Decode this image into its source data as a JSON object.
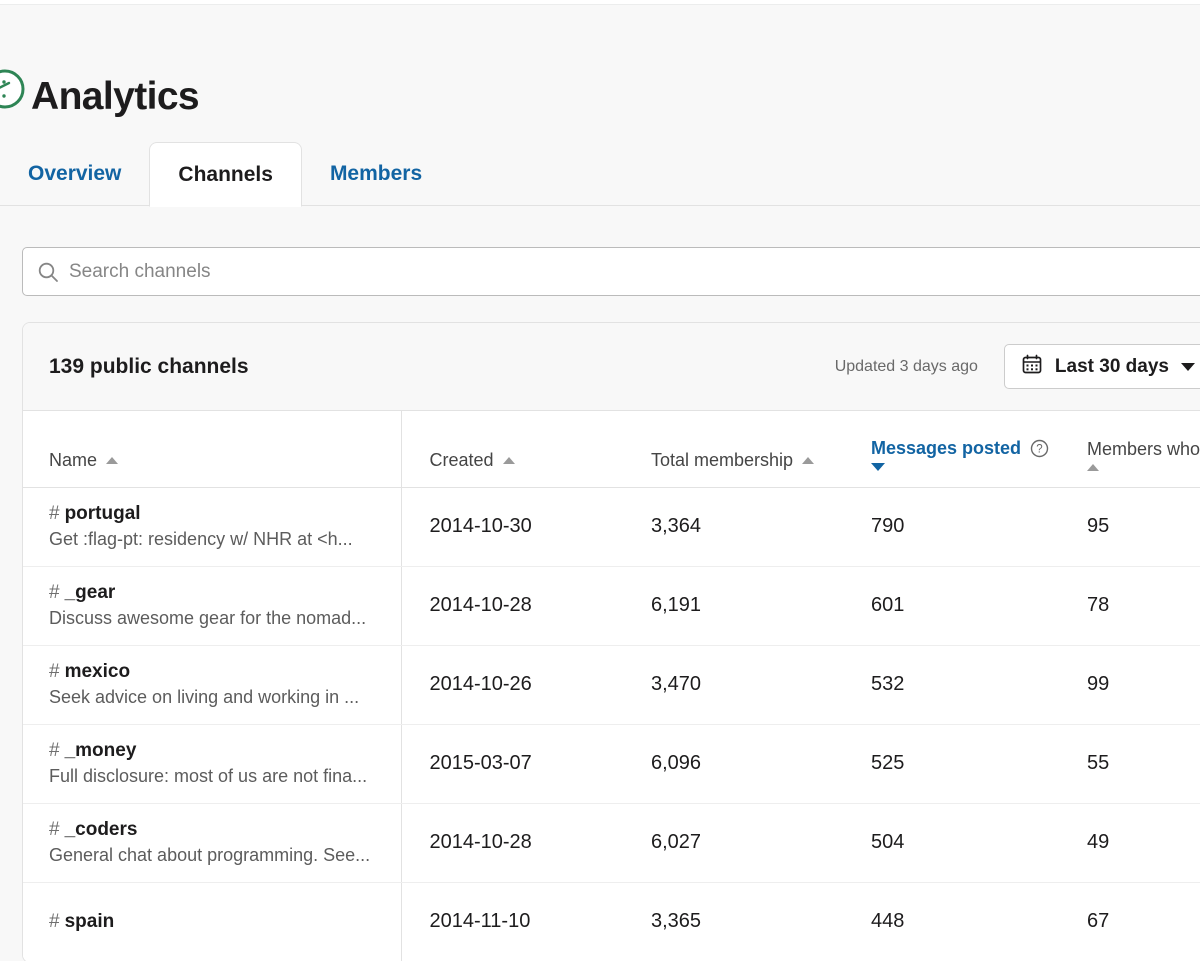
{
  "header": {
    "title": "Analytics",
    "logo_icon": "analytics-gauge-icon"
  },
  "tabs": [
    {
      "label": "Overview",
      "active": false
    },
    {
      "label": "Channels",
      "active": true
    },
    {
      "label": "Members",
      "active": false
    }
  ],
  "search": {
    "placeholder": "Search channels",
    "value": "",
    "icon": "search-icon"
  },
  "card": {
    "title": "139 public channels",
    "updated_text": "Updated 3 days ago",
    "date_range": {
      "label": "Last 30 days",
      "icon": "calendar-icon",
      "caret": "chevron-down-icon"
    }
  },
  "table": {
    "columns": [
      {
        "key": "name",
        "label": "Name",
        "sort": "asc",
        "sorted": false,
        "help": false
      },
      {
        "key": "created",
        "label": "Created",
        "sort": "asc",
        "sorted": false,
        "help": false
      },
      {
        "key": "total",
        "label": "Total membership",
        "sort": "asc",
        "sorted": false,
        "help": false
      },
      {
        "key": "msgs",
        "label": "Messages posted",
        "sort": "desc",
        "sorted": true,
        "help": true
      },
      {
        "key": "posted",
        "label": "Members who po",
        "sort": "asc",
        "sorted": false,
        "help": false
      }
    ],
    "rows": [
      {
        "name": "portugal",
        "description": "Get :flag-pt: residency w/ NHR at <h...",
        "created": "2014-10-30",
        "total_membership": "3,364",
        "messages_posted": "790",
        "members_who_posted": "95"
      },
      {
        "name": "_gear",
        "description": "Discuss awesome gear for the nomad...",
        "created": "2014-10-28",
        "total_membership": "6,191",
        "messages_posted": "601",
        "members_who_posted": "78"
      },
      {
        "name": "mexico",
        "description": "Seek advice on living and working in ...",
        "created": "2014-10-26",
        "total_membership": "3,470",
        "messages_posted": "532",
        "members_who_posted": "99"
      },
      {
        "name": "_money",
        "description": "Full disclosure: most of us are not fina...",
        "created": "2015-03-07",
        "total_membership": "6,096",
        "messages_posted": "525",
        "members_who_posted": "55"
      },
      {
        "name": "_coders",
        "description": "General chat about programming. See...",
        "created": "2014-10-28",
        "total_membership": "6,027",
        "messages_posted": "504",
        "members_who_posted": "49"
      },
      {
        "name": "spain",
        "description": "",
        "created": "2014-11-10",
        "total_membership": "3,365",
        "messages_posted": "448",
        "members_who_posted": "67"
      }
    ]
  },
  "colors": {
    "link_blue": "#1264a3",
    "text_primary": "#1d1c1d",
    "text_muted": "#696969",
    "border": "#e2e2e2",
    "page_bg": "#f8f8f8",
    "logo_green": "#2e8555"
  }
}
